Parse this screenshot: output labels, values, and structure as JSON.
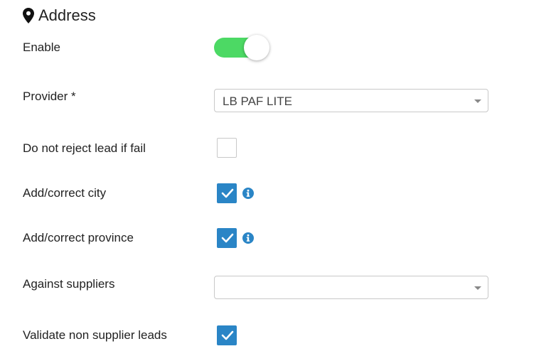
{
  "section": {
    "title": "Address",
    "icon": "map-pin-icon"
  },
  "fields": {
    "enable": {
      "label": "Enable",
      "on": true,
      "color_on": "#4cd964"
    },
    "provider": {
      "label": "Provider *",
      "value": "LB PAF LITE"
    },
    "do_not_reject": {
      "label": "Do not reject lead if fail",
      "checked": false
    },
    "add_correct_city": {
      "label": "Add/correct city",
      "checked": true,
      "info_icon": "info-icon"
    },
    "add_correct_province": {
      "label": "Add/correct province",
      "checked": true,
      "info_icon": "info-icon"
    },
    "against_suppliers": {
      "label": "Against suppliers",
      "value": ""
    },
    "validate_non_supplier": {
      "label": "Validate non supplier leads",
      "checked": true
    }
  },
  "colors": {
    "accent": "#2a85c6",
    "toggle_on": "#4cd964"
  }
}
